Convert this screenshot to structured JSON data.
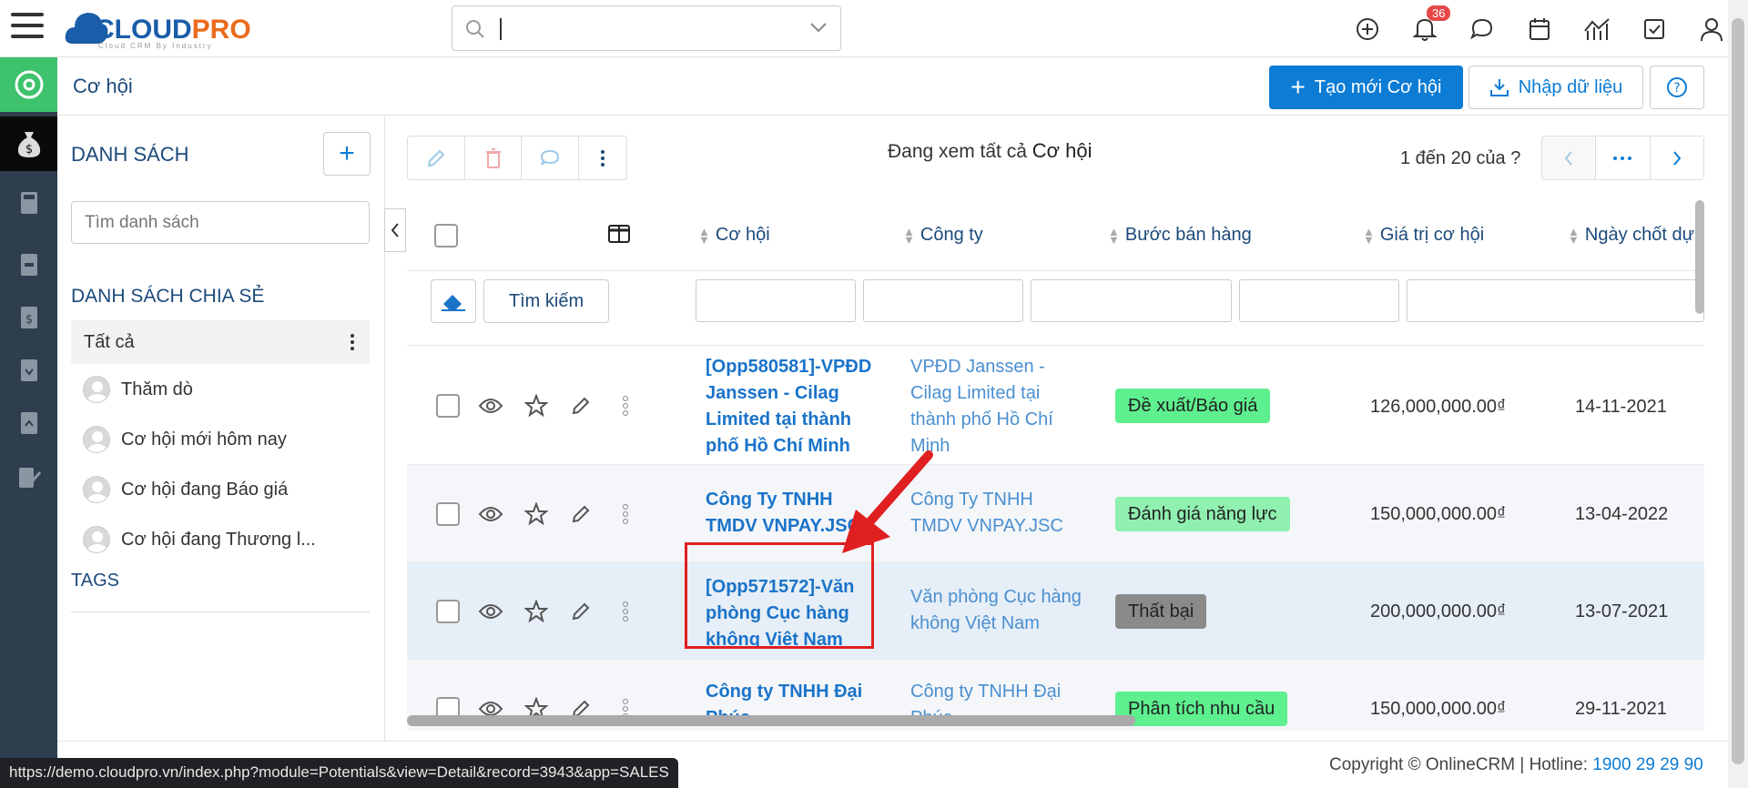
{
  "app": {
    "logo_main": "CLOUD",
    "logo_accent": "PRO",
    "logo_sub": "Cloud CRM By Industry",
    "notifications_count": "36"
  },
  "header": {
    "title": "Cơ hội",
    "create_label": "Tạo mới Cơ hội",
    "import_label": "Nhập dữ liệu"
  },
  "sidebar": {
    "title": "DANH SÁCH",
    "search_placeholder": "Tìm danh sách",
    "shared_title": "DANH SÁCH CHIA SẺ",
    "all_label": "Tất cả",
    "items": [
      {
        "label": "Thăm dò"
      },
      {
        "label": "Cơ hội mới hôm nay"
      },
      {
        "label": "Cơ hội đang Báo giá"
      },
      {
        "label": "Cơ hội đang Thương l..."
      }
    ],
    "tags_title": "TAGS"
  },
  "main": {
    "viewing_prefix": "Đang xem tất cả",
    "viewing_module": "Cơ hội",
    "pager_text": "1 đến 20 của",
    "pager_q": "?",
    "search_button": "Tìm kiếm"
  },
  "table": {
    "columns": [
      "Cơ hội",
      "Công ty",
      "Bước bán hàng",
      "Giá trị cơ hội",
      "Ngày chốt dự"
    ],
    "rows": [
      {
        "opp": "[Opp580581]-VPĐD Janssen - Cilag Limited tại thành phố Hồ Chí Minh",
        "company": "VPĐD Janssen - Cilag Limited tại thành phố Hồ Chí Minh",
        "stage": "Đề xuất/Báo giá",
        "stage_color": "#5ef08f",
        "value": "126,000,000.00₫",
        "date": "14-11-2021"
      },
      {
        "opp": "Công Ty TNHH TMDV VNPAY.JSC",
        "company": "Công Ty TNHH TMDV VNPAY.JSC",
        "stage": "Đánh giá năng lực",
        "stage_color": "#8ff0b0",
        "value": "150,000,000.00₫",
        "date": "13-04-2022"
      },
      {
        "opp": "[Opp571572]-Văn phòng Cục hàng không Việt Nam",
        "company": "Văn phòng Cục hàng không Việt Nam",
        "stage": "Thất bại",
        "stage_color": "#8a8a8a",
        "value": "200,000,000.00₫",
        "date": "13-07-2021"
      },
      {
        "opp": "Công ty TNHH Đại Phúc",
        "company": "Công ty TNHH Đại Phúc",
        "stage": "Phân tích nhu cầu",
        "stage_color": "#5ef08f",
        "value": "150,000,000.00₫",
        "date": "29-11-2021"
      }
    ]
  },
  "footer": {
    "copyright": "Copyright © OnlineCRM",
    "hotline_label": "Hotline:",
    "hotline": "1900 29 29 90"
  },
  "status_url": "https://demo.cloudpro.vn/index.php?module=Potentials&view=Detail&record=3943&app=SALES",
  "colors": {
    "accent": "#0c7cd5",
    "rail": "#2e3e4e",
    "green": "#3ec26e",
    "annotation": "#e02020"
  }
}
